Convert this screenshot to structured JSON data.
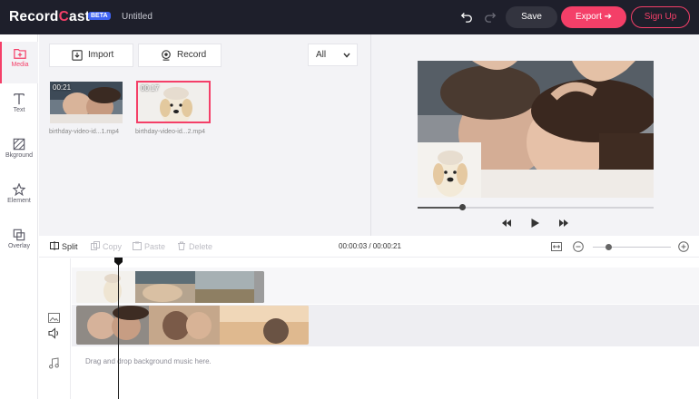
{
  "app": {
    "logo_main": "Record",
    "logo_accent": "C",
    "logo_rest": "ast",
    "beta": "BETA",
    "doc_title": "Untitled"
  },
  "header": {
    "save": "Save",
    "export": "Export",
    "signup": "Sign Up"
  },
  "sidebar": {
    "items": [
      {
        "label": "Media",
        "icon": "folder-plus-icon"
      },
      {
        "label": "Text",
        "icon": "text-icon"
      },
      {
        "label": "Bkground",
        "icon": "background-icon"
      },
      {
        "label": "Element",
        "icon": "star-icon"
      },
      {
        "label": "Overlay",
        "icon": "overlay-icon"
      }
    ]
  },
  "media": {
    "import": "Import",
    "record": "Record",
    "filter": "All",
    "items": [
      {
        "duration": "00:21",
        "filename": "birthday-video-id...1.mp4"
      },
      {
        "duration": "00:17",
        "filename": "birthday-video-id...2.mp4"
      }
    ]
  },
  "preview": {
    "progress": 0.19
  },
  "toolbar": {
    "split": "Split",
    "copy": "Copy",
    "paste": "Paste",
    "delete": "Delete",
    "timecode": "00:00:03 / 00:00:21",
    "zoom": 0.2
  },
  "timeline": {
    "music_hint": "Drag and drop background music here."
  },
  "colors": {
    "accent": "#f43f68",
    "topbar": "#1e1f2b",
    "beta": "#3f63f2"
  }
}
